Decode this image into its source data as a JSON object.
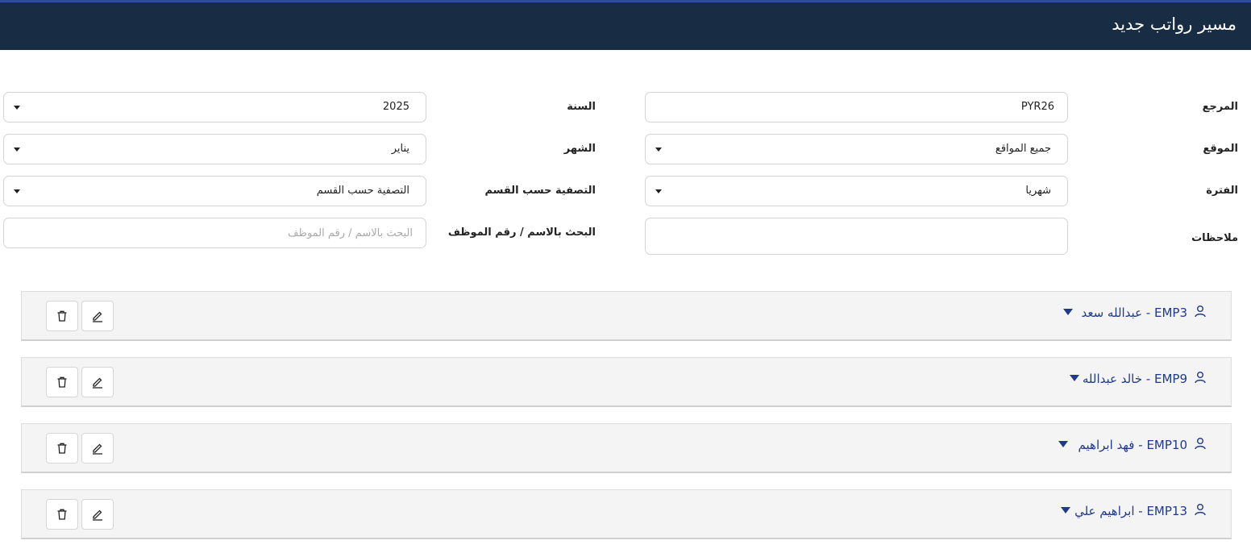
{
  "header": {
    "title": "مسير رواتب جديد"
  },
  "form": {
    "reference": {
      "label": "المرجع",
      "value": "PYR26"
    },
    "year": {
      "label": "السنة",
      "value": "2025"
    },
    "location": {
      "label": "الموقع",
      "value": "جميع المواقع"
    },
    "month": {
      "label": "الشهر",
      "value": "يناير"
    },
    "period": {
      "label": "الفترة",
      "value": "شهريا"
    },
    "department_filter": {
      "label": "التصفية حسب القسم",
      "value": "التصفية حسب القسم"
    },
    "notes": {
      "label": "ملاحظات",
      "value": ""
    },
    "search": {
      "label": "البحث بالاسم / رقم الموظف",
      "placeholder": "البحث بالاسم / رقم الموظف"
    }
  },
  "employees": [
    {
      "label": "EMP3 - عبدالله سعد"
    },
    {
      "label": "EMP9 - خالد عبدالله"
    },
    {
      "label": "EMP10 - فهد ابراهيم"
    },
    {
      "label": "EMP13 - ابراهيم علي"
    }
  ],
  "icons": {
    "person": "person-icon",
    "expand": "caret-down-icon",
    "edit": "pencil-icon",
    "delete": "trash-icon"
  },
  "colors": {
    "header_bg": "#182c44",
    "header_accent": "#2f4d9a",
    "employee_name": "#1f3a8a",
    "row_bg": "#f4f4f4"
  }
}
